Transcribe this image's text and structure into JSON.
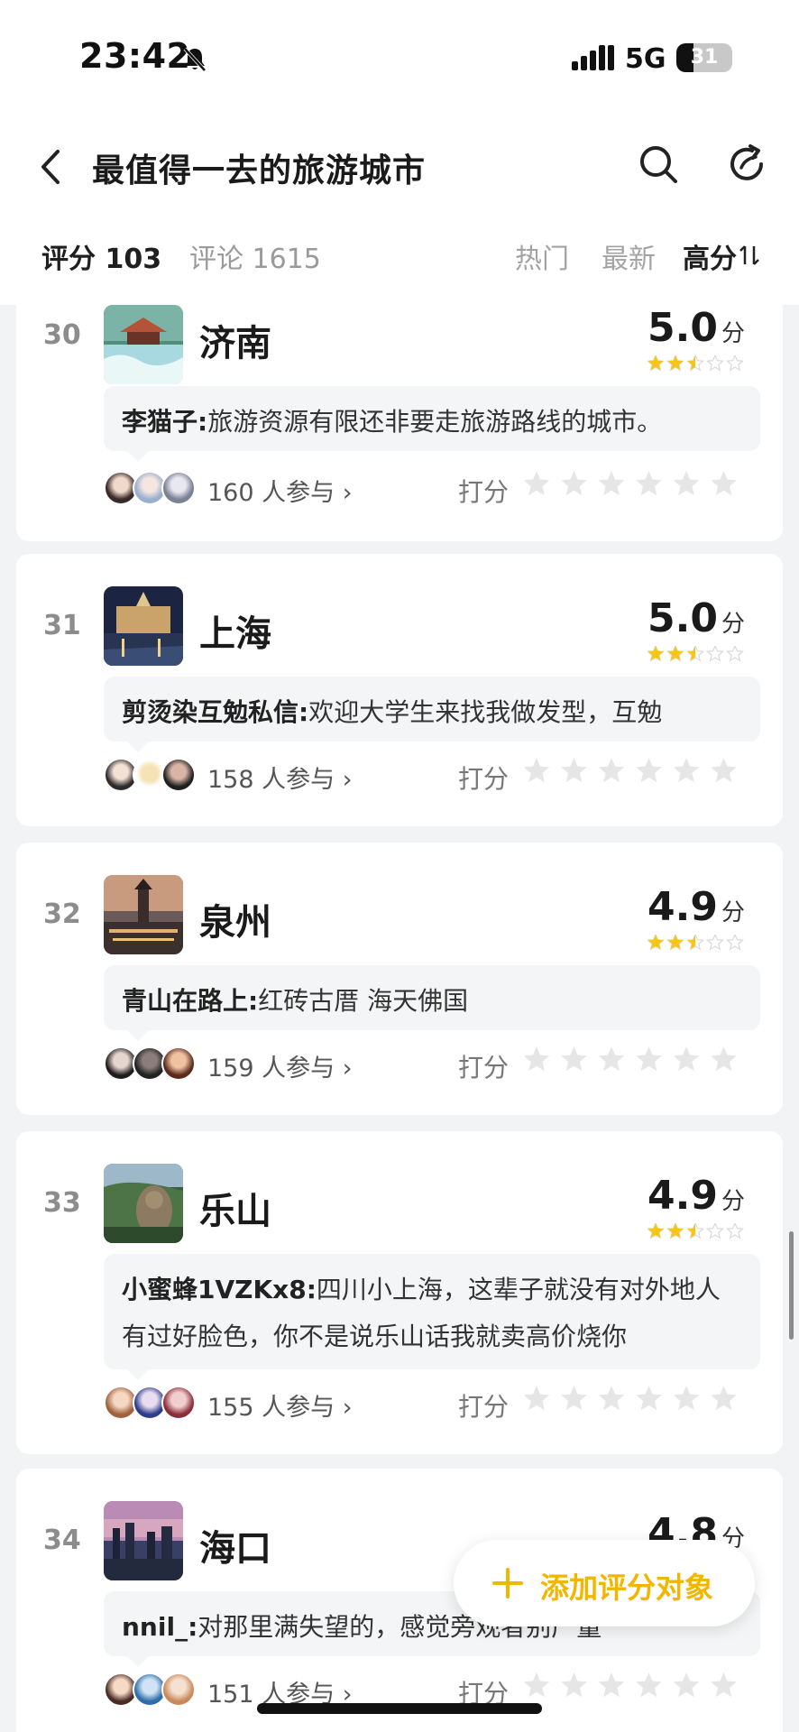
{
  "status_bar": {
    "time": "23:42",
    "network": "5G",
    "battery": "31",
    "battery_level": 0.31
  },
  "header": {
    "title": "最值得一去的旅游城市"
  },
  "tabs": {
    "rating": "评分 103",
    "comments": "评论 1615",
    "sort": {
      "hot": "热门",
      "newest": "最新",
      "highest": "高分",
      "sort_icon": "sort-arrows-icon"
    }
  },
  "colors": {
    "star": "#f5c518",
    "accent": "#f2b600",
    "rank": "#8c8c8c",
    "star_empty": "#e6e6e6"
  },
  "items": [
    {
      "rank": "30",
      "city": "济南",
      "score": "5.0",
      "unit": "分",
      "rating_stars": 2.5,
      "author": "李猫子:",
      "comment": "旅游资源有限还非要走旅游路线的城市。",
      "participants": "160 人参与 ›",
      "rate_label": "打分"
    },
    {
      "rank": "31",
      "city": "上海",
      "score": "5.0",
      "unit": "分",
      "rating_stars": 2.5,
      "author": "剪烫染互勉私信:",
      "comment": "欢迎大学生来找我做发型，互勉",
      "participants": "158 人参与 ›",
      "rate_label": "打分"
    },
    {
      "rank": "32",
      "city": "泉州",
      "score": "4.9",
      "unit": "分",
      "rating_stars": 2.5,
      "author": "青山在路上:",
      "comment": "红砖古厝 海天佛国",
      "participants": "159 人参与 ›",
      "rate_label": "打分"
    },
    {
      "rank": "33",
      "city": "乐山",
      "score": "4.9",
      "unit": "分",
      "rating_stars": 2.5,
      "author": "小蜜蜂1VZKx8:",
      "comment": "四川小上海，这辈子就没有对外地人有过好脸色，你不是说乐山话我就卖高价烧你",
      "participants": "155 人参与 ›",
      "rate_label": "打分"
    },
    {
      "rank": "34",
      "city": "海口",
      "score": "4.8",
      "unit": "分",
      "rating_stars": 2.5,
      "author": "nnil_:",
      "comment": "对那里满失望的，感觉旁观者别产量",
      "participants": "151 人参与 ›",
      "rate_label": "打分"
    }
  ],
  "add_button": {
    "label": "添加评分对象"
  }
}
